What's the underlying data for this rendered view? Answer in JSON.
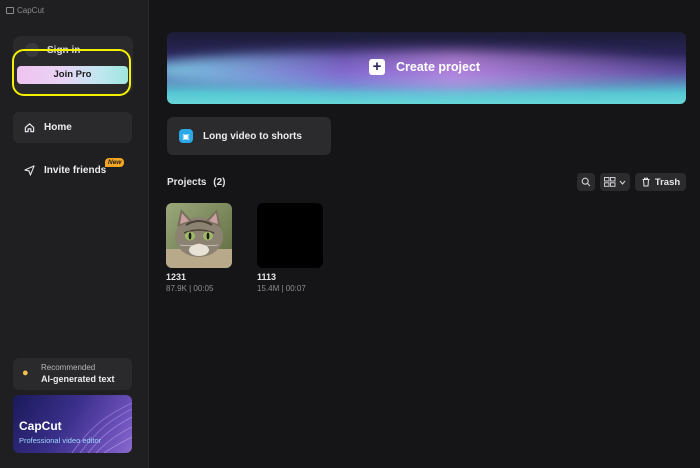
{
  "app": {
    "title": "CapCut"
  },
  "sidebar": {
    "sign_in": "Sign in",
    "join_pro": "Join Pro",
    "nav": [
      {
        "label": "Home",
        "icon": "home-icon"
      },
      {
        "label": "Invite friends",
        "icon": "send-icon",
        "badge": "New"
      }
    ],
    "recommended": {
      "label": "Recommended",
      "title": "AI-generated text",
      "icon": "lightbulb-icon"
    },
    "promo": {
      "title": "CapCut",
      "subtitle": "Professional video editor"
    }
  },
  "titlebar": {
    "icons": [
      "feedback-icon",
      "settings-icon",
      "minimize-icon",
      "maximize-icon",
      "close-icon"
    ]
  },
  "main": {
    "create_project": "Create project",
    "long_video": "Long video to shorts",
    "projects": {
      "title": "Projects",
      "count": "(2)"
    },
    "toolbar": {
      "trash_label": "Trash"
    },
    "cards": [
      {
        "name": "1231",
        "meta": "87.9K | 00:05"
      },
      {
        "name": "1113",
        "meta": "15.4M | 00:07"
      }
    ]
  },
  "colors": {
    "accent": "#21c8d8",
    "highlight": "#f4f000",
    "new_badge": "#f6a623"
  }
}
